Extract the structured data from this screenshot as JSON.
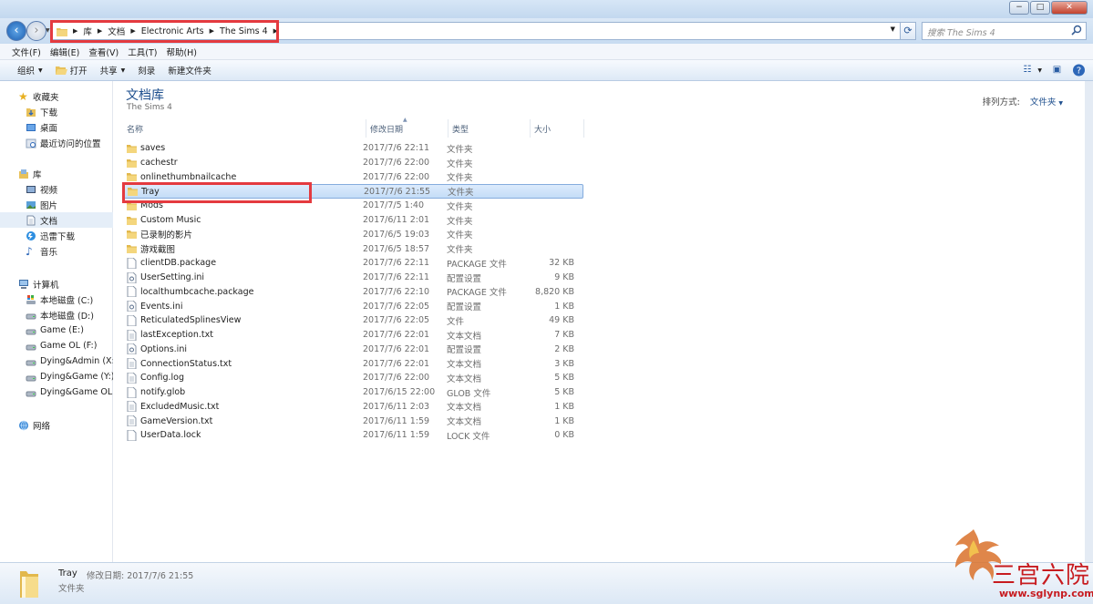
{
  "window": {
    "minimize": "−",
    "maximize": "□",
    "close": "✕"
  },
  "address": {
    "crumbs": [
      "库",
      "文档",
      "Electronic Arts",
      "The Sims 4"
    ],
    "search_placeholder": "搜索 The Sims 4"
  },
  "menubar": [
    "文件(F)",
    "编辑(E)",
    "查看(V)",
    "工具(T)",
    "帮助(H)"
  ],
  "toolbar": {
    "organize": "组织",
    "open": "打开",
    "share": "共享",
    "burn": "刻录",
    "new_folder": "新建文件夹"
  },
  "sidebar": {
    "favorites": {
      "label": "收藏夹",
      "items": [
        "下载",
        "桌面",
        "最近访问的位置"
      ]
    },
    "libraries": {
      "label": "库",
      "items": [
        "视频",
        "图片",
        "文档",
        "迅雷下载",
        "音乐"
      ]
    },
    "computer": {
      "label": "计算机",
      "items": [
        "本地磁盘 (C:)",
        "本地磁盘 (D:)",
        "Game (E:)",
        "Game OL (F:)",
        "Dying&Admin (X:)",
        "Dying&Game (Y:)",
        "Dying&Game OL ("
      ]
    },
    "network": {
      "label": "网络"
    }
  },
  "library": {
    "title": "文档库",
    "subtitle": "The Sims 4",
    "arrange_label": "排列方式:",
    "arrange_value": "文件夹"
  },
  "columns": {
    "name": "名称",
    "date": "修改日期",
    "type": "类型",
    "size": "大小"
  },
  "files": [
    {
      "name": "saves",
      "date": "2017/7/6 22:11",
      "type": "文件夹",
      "size": "",
      "kind": "folder"
    },
    {
      "name": "cachestr",
      "date": "2017/7/6 22:00",
      "type": "文件夹",
      "size": "",
      "kind": "folder"
    },
    {
      "name": "onlinethumbnailcache",
      "date": "2017/7/6 22:00",
      "type": "文件夹",
      "size": "",
      "kind": "folder"
    },
    {
      "name": "Tray",
      "date": "2017/7/6 21:55",
      "type": "文件夹",
      "size": "",
      "kind": "folder",
      "selected": true
    },
    {
      "name": "Mods",
      "date": "2017/7/5 1:40",
      "type": "文件夹",
      "size": "",
      "kind": "folder"
    },
    {
      "name": "Custom Music",
      "date": "2017/6/11 2:01",
      "type": "文件夹",
      "size": "",
      "kind": "folder"
    },
    {
      "name": "已录制的影片",
      "date": "2017/6/5 19:03",
      "type": "文件夹",
      "size": "",
      "kind": "folder"
    },
    {
      "name": "游戏截图",
      "date": "2017/6/5 18:57",
      "type": "文件夹",
      "size": "",
      "kind": "folder"
    },
    {
      "name": "clientDB.package",
      "date": "2017/7/6 22:11",
      "type": "PACKAGE 文件",
      "size": "32 KB",
      "kind": "file"
    },
    {
      "name": "UserSetting.ini",
      "date": "2017/7/6 22:11",
      "type": "配置设置",
      "size": "9 KB",
      "kind": "ini"
    },
    {
      "name": "localthumbcache.package",
      "date": "2017/7/6 22:10",
      "type": "PACKAGE 文件",
      "size": "8,820 KB",
      "kind": "file"
    },
    {
      "name": "Events.ini",
      "date": "2017/7/6 22:05",
      "type": "配置设置",
      "size": "1 KB",
      "kind": "ini"
    },
    {
      "name": "ReticulatedSplinesView",
      "date": "2017/7/6 22:05",
      "type": "文件",
      "size": "49 KB",
      "kind": "file"
    },
    {
      "name": "lastException.txt",
      "date": "2017/7/6 22:01",
      "type": "文本文档",
      "size": "7 KB",
      "kind": "txt"
    },
    {
      "name": "Options.ini",
      "date": "2017/7/6 22:01",
      "type": "配置设置",
      "size": "2 KB",
      "kind": "ini"
    },
    {
      "name": "ConnectionStatus.txt",
      "date": "2017/7/6 22:01",
      "type": "文本文档",
      "size": "3 KB",
      "kind": "txt"
    },
    {
      "name": "Config.log",
      "date": "2017/7/6 22:00",
      "type": "文本文档",
      "size": "5 KB",
      "kind": "txt"
    },
    {
      "name": "notify.glob",
      "date": "2017/6/15 22:00",
      "type": "GLOB 文件",
      "size": "5 KB",
      "kind": "file"
    },
    {
      "name": "ExcludedMusic.txt",
      "date": "2017/6/11 2:03",
      "type": "文本文档",
      "size": "1 KB",
      "kind": "txt"
    },
    {
      "name": "GameVersion.txt",
      "date": "2017/6/11 1:59",
      "type": "文本文档",
      "size": "1 KB",
      "kind": "txt"
    },
    {
      "name": "UserData.lock",
      "date": "2017/6/11 1:59",
      "type": "LOCK 文件",
      "size": "0 KB",
      "kind": "file"
    }
  ],
  "details": {
    "name": "Tray",
    "moddate": "修改日期: 2017/7/6 21:55",
    "type": "文件夹"
  },
  "watermark": {
    "text": "三宫六院",
    "url": "www.sglynp.com"
  }
}
